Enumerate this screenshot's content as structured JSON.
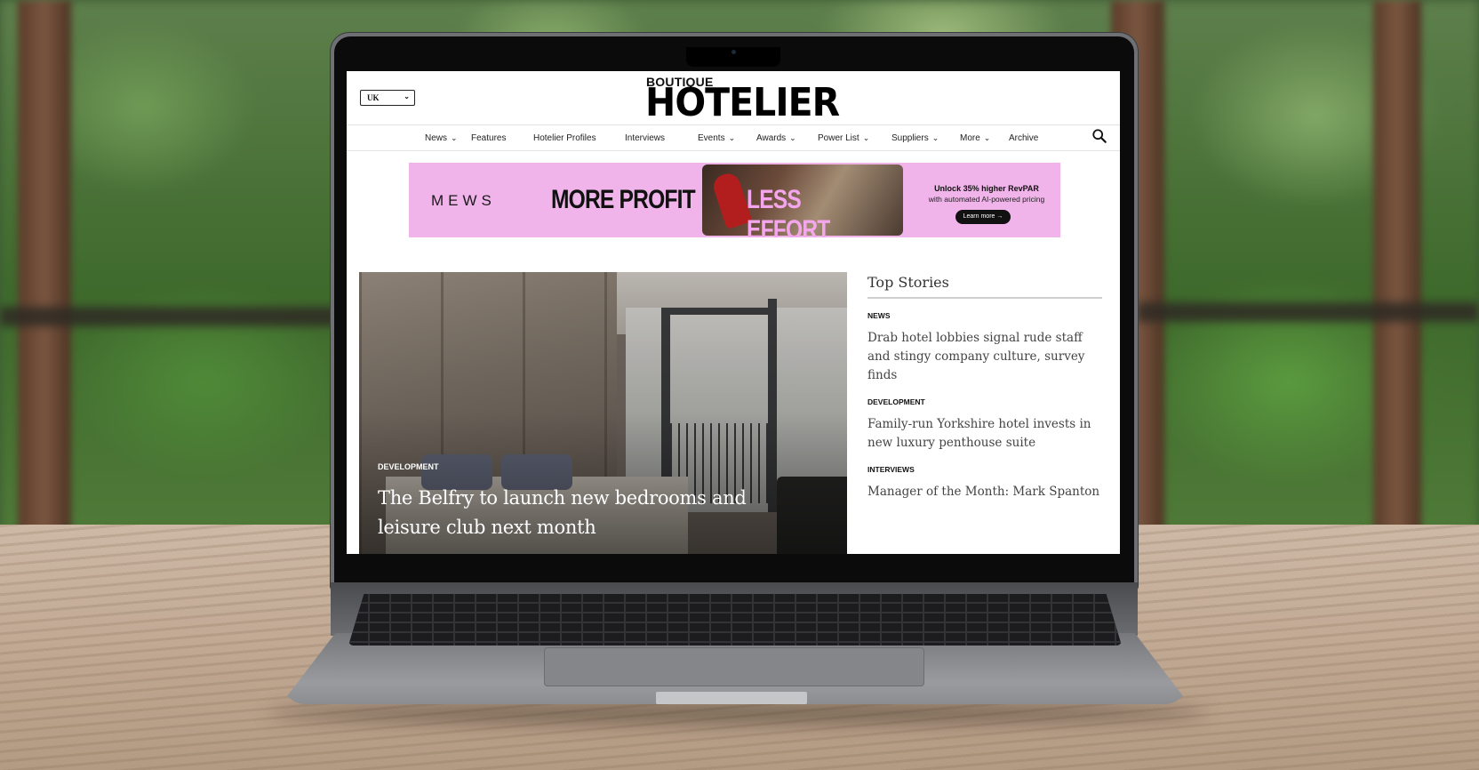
{
  "site": {
    "region": "UK",
    "logo_top": "BOUTIQUE",
    "logo_main": "HOTELIER"
  },
  "nav": {
    "items": [
      {
        "label": "News",
        "dropdown": true
      },
      {
        "label": "Features",
        "dropdown": false
      },
      {
        "label": "Hotelier Profiles",
        "dropdown": false
      },
      {
        "label": "Interviews",
        "dropdown": false
      },
      {
        "label": "Events",
        "dropdown": true
      },
      {
        "label": "Awards",
        "dropdown": true
      },
      {
        "label": "Power List",
        "dropdown": true
      },
      {
        "label": "Suppliers",
        "dropdown": true
      },
      {
        "label": "More",
        "dropdown": true
      },
      {
        "label": "Archive",
        "dropdown": false
      }
    ]
  },
  "ad": {
    "brand": "MEWS",
    "headline_left": "MORE PROFIT",
    "headline_right": "LESS EFFORT",
    "tagline": "Unlock 35% higher RevPAR",
    "subline": "with automated AI-powered pricing",
    "cta": "Learn more →",
    "background_color": "#f0b4ea"
  },
  "hero": {
    "category": "DEVELOPMENT",
    "title": "The Belfry to launch new bedrooms and leisure club next month"
  },
  "top_stories": {
    "heading": "Top Stories",
    "items": [
      {
        "category": "NEWS",
        "title": "Drab hotel lobbies signal rude staff and stingy company culture, survey finds"
      },
      {
        "category": "DEVELOPMENT",
        "title": "Family-run Yorkshire hotel invests in new luxury penthouse suite"
      },
      {
        "category": "INTERVIEWS",
        "title": "Manager of the Month: Mark Spanton"
      }
    ]
  },
  "icons": {
    "search": "search-icon",
    "chevron": "chevron-down-icon"
  }
}
